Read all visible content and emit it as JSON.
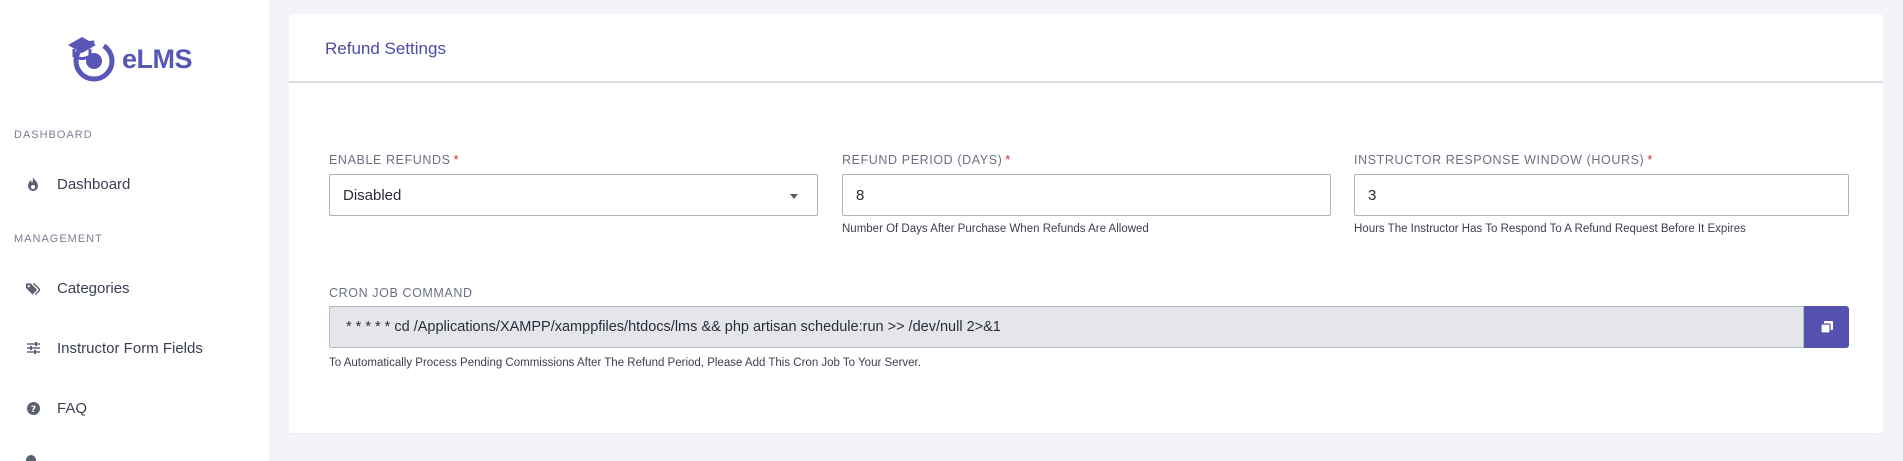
{
  "app": {
    "brand": "eLMS"
  },
  "sidebar": {
    "sections": [
      {
        "title": "DASHBOARD",
        "items": [
          {
            "label": "Dashboard",
            "icon": "fire-icon"
          }
        ]
      },
      {
        "title": "MANAGEMENT",
        "items": [
          {
            "label": "Categories",
            "icon": "tags-icon"
          },
          {
            "label": "Instructor Form Fields",
            "icon": "sliders-icon"
          },
          {
            "label": "FAQ",
            "icon": "question-circle-icon"
          }
        ]
      }
    ]
  },
  "page": {
    "title": "Refund Settings"
  },
  "form": {
    "enable_refunds": {
      "label": "ENABLE REFUNDS",
      "required": "*",
      "value": "Disabled"
    },
    "refund_period": {
      "label": "REFUND PERIOD (DAYS)",
      "required": "*",
      "value": "8",
      "help": "Number Of Days After Purchase When Refunds Are Allowed"
    },
    "response_window": {
      "label": "INSTRUCTOR RESPONSE WINDOW (HOURS)",
      "required": "*",
      "value": "3",
      "help": "Hours The Instructor Has To Respond To A Refund Request Before It Expires"
    },
    "cron": {
      "label": "CRON JOB COMMAND",
      "value": "* * * * * cd /Applications/XAMPP/xamppfiles/htdocs/lms && php artisan schedule:run >> /dev/null 2>&1",
      "help": "To Automatically Process Pending Commissions After The Refund Period, Please Add This Cron Job To Your Server."
    }
  },
  "colors": {
    "accent": "#5451b0",
    "required": "#e0242e",
    "background": "#f2f4f7"
  }
}
